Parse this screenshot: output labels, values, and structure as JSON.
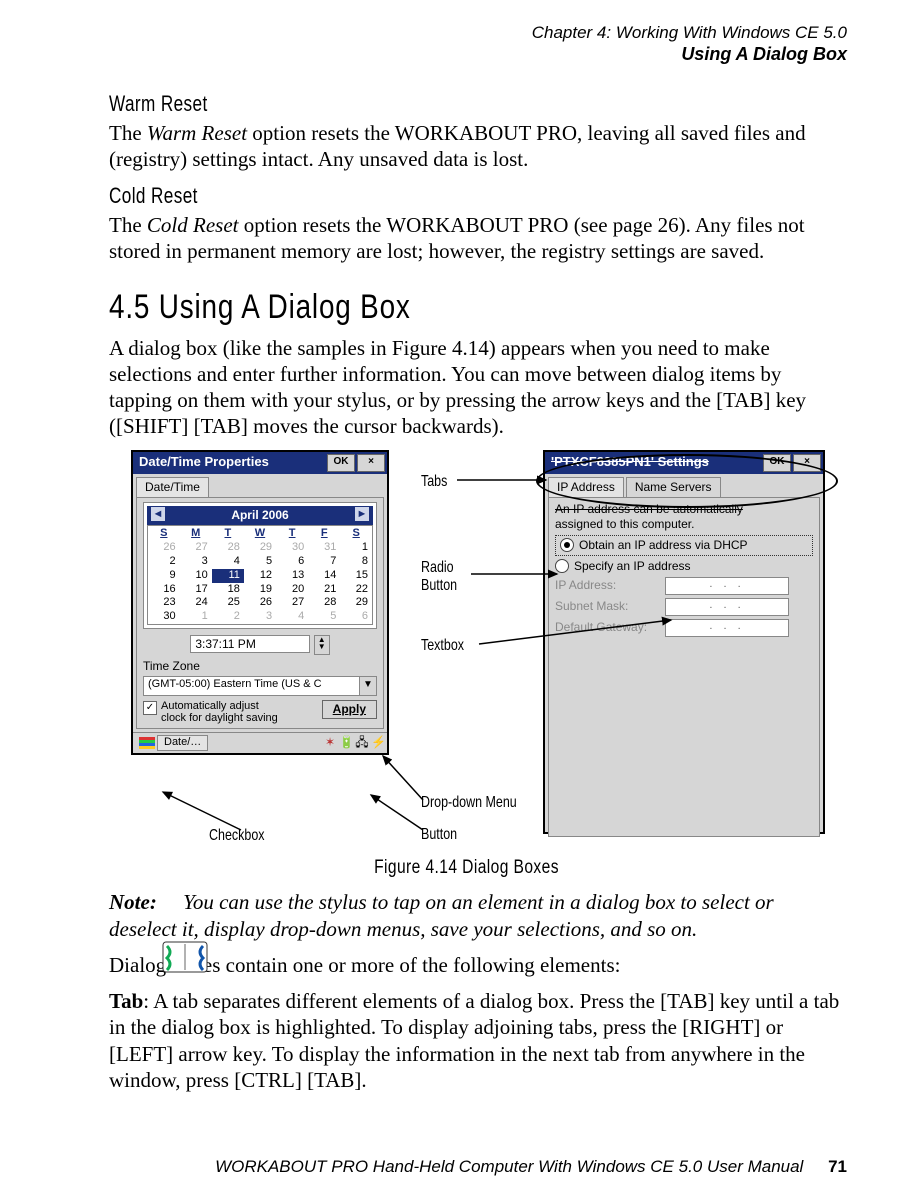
{
  "header": {
    "chapter": "Chapter 4: Working With Windows CE 5.0",
    "section": "Using A Dialog Box"
  },
  "warm": {
    "title": "Warm Reset",
    "body_a": "The ",
    "body_b": "Warm Reset",
    "body_c": " option resets the WORKABOUT PRO, leaving all saved files and (registry) settings intact. Any unsaved data is lost."
  },
  "cold": {
    "title": "Cold Reset",
    "body_a": "The ",
    "body_b": "Cold Reset",
    "body_c": " option resets the WORKABOUT PRO (see page 26). Any files not stored in permanent memory are lost; however, the registry settings are saved."
  },
  "main": {
    "heading": "4.5   Using A Dialog Box",
    "para": "A dialog box (like the samples in Figure 4.14) appears when you need to make selections and enter further information. You can move between dialog items by tapping on them with your stylus, or by pressing the arrow keys and the [TAB] key ([SHIFT] [TAB] moves the cursor backwards)."
  },
  "dlg_left": {
    "title": "Date/Time Properties",
    "ok": "OK",
    "close": "×",
    "tab": "Date/Time",
    "month": "April 2006",
    "dow": [
      "S",
      "M",
      "T",
      "W",
      "T",
      "F",
      "S"
    ],
    "rows": [
      [
        "26",
        "27",
        "28",
        "29",
        "30",
        "31",
        "1"
      ],
      [
        "2",
        "3",
        "4",
        "5",
        "6",
        "7",
        "8"
      ],
      [
        "9",
        "10",
        "11",
        "12",
        "13",
        "14",
        "15"
      ],
      [
        "16",
        "17",
        "18",
        "19",
        "20",
        "21",
        "22"
      ],
      [
        "23",
        "24",
        "25",
        "26",
        "27",
        "28",
        "29"
      ],
      [
        "30",
        "1",
        "2",
        "3",
        "4",
        "5",
        "6"
      ]
    ],
    "sel_row": 2,
    "sel_col": 2,
    "time": "3:37:11 PM",
    "tz_label": "Time Zone",
    "tz_value": "(GMT-05:00) Eastern Time (US & C",
    "chk_label_a": "Automatically adjust",
    "chk_label_b": "clock for daylight saving",
    "apply": "Apply",
    "task_item": "Date/…"
  },
  "dlg_right": {
    "title": "'PTXCF8385PN1' Settings",
    "ok": "OK",
    "close": "×",
    "tab_a": "IP Address",
    "tab_b": "Name Servers",
    "desc_a": "An IP address can be automatically",
    "desc_b": "assigned to this computer.",
    "opt_a": "Obtain an IP address via DHCP",
    "opt_b": "Specify an IP address",
    "f1": "IP Address:",
    "f2": "Subnet Mask:",
    "f3": "Default Gateway:",
    "ipdots": ".     .     ."
  },
  "annotations": {
    "tabs": "Tabs",
    "radio_a": "Radio",
    "radio_b": "Button",
    "textbox": "Textbox",
    "dropdown": "Drop-down Menu",
    "button": "Button",
    "checkbox": "Checkbox"
  },
  "figcap": "Figure 4.14 Dialog Boxes",
  "note": {
    "label": "Note:",
    "text": "You can use the stylus to tap on an element in a dialog box to select or deselect it, display drop-down menus, save your selections, and so on."
  },
  "after_note": "Dialog boxes contain one or more of the following elements:",
  "tab_para_a": "Tab",
  "tab_para_b": ": A tab separates different elements of a dialog box. Press the [TAB] key until a tab in the dialog box is highlighted. To display adjoining tabs, press the [RIGHT] or [LEFT] arrow key. To display the information in the next tab from anywhere in the window, press [CTRL] [TAB].",
  "footer": {
    "text": "WORKABOUT PRO Hand-Held Computer With Windows CE 5.0 User Manual",
    "page": "71"
  }
}
